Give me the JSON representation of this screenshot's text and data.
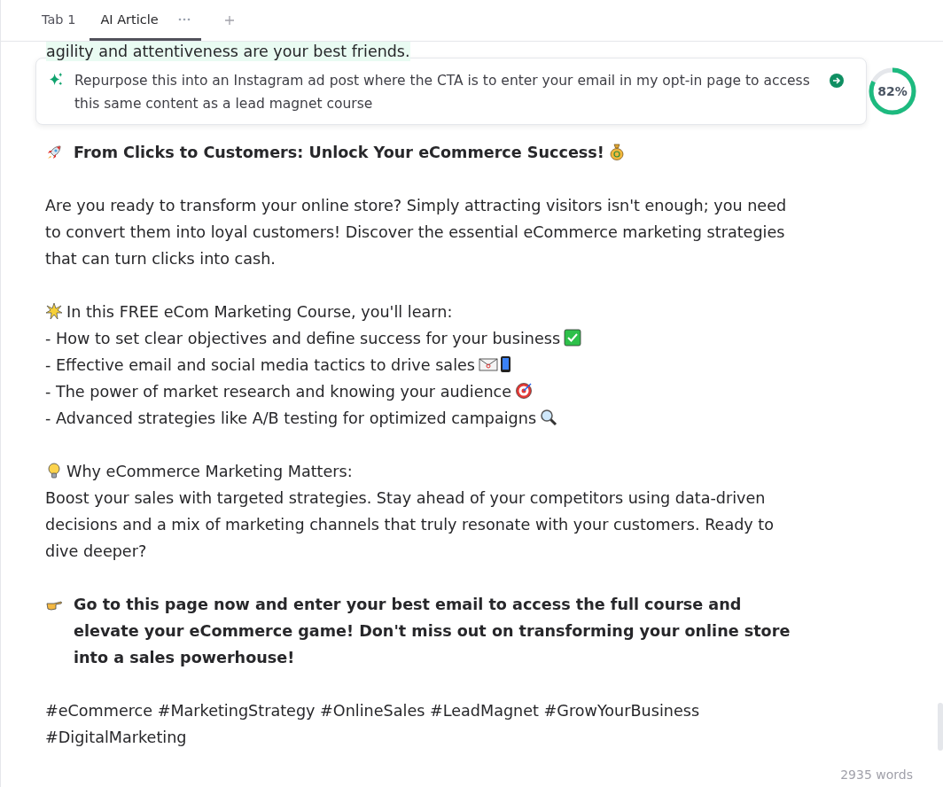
{
  "tabs": [
    {
      "label": "Tab 1",
      "selected": false
    },
    {
      "label": "AI Article",
      "selected": true
    }
  ],
  "hidden_line": "agility and attentiveness are your best friends.",
  "prompt": {
    "text": "Repurpose this into an Instagram ad post where the CTA is to enter your email in my opt-in page to access this same content as a lead magnet course"
  },
  "progress": {
    "level": 0.82,
    "label": "82%"
  },
  "blocks": [
    {
      "kind": "heading",
      "text": "From Clicks to Customers: Unlock Your eCommerce Success!"
    },
    {
      "kind": "paragraph",
      "text": "Are you ready to transform your online store? Simply attracting visitors isn't enough; you need to convert them into loyal customers! Discover the essential eCommerce marketing strategies that can turn clicks into cash."
    },
    {
      "kind": "list",
      "intro": "In this FREE eCom Marketing Course, you'll learn:",
      "items": [
        "- How to set clear objectives and define success for your business",
        "- Effective email and social media tactics to drive sales",
        "- The power of market research and knowing your audience",
        "- Advanced strategies like A/B testing for optimized campaigns"
      ]
    },
    {
      "kind": "list",
      "intro": "Why eCommerce Marketing Matters:",
      "items": [
        "Boost your sales with targeted strategies. Stay ahead of your competitors using data-driven decisions and a mix of marketing channels that truly resonate with your customers. Ready to dive deeper?"
      ]
    },
    {
      "kind": "heading",
      "text": "Go to this page now and enter your best email to access the full course and elevate your eCommerce game! Don't miss out on transforming your online store into a sales powerhouse!"
    },
    {
      "kind": "paragraph",
      "text": "#eCommerce #MarketingStrategy #OnlineSales #LeadMagnet #GrowYourBusiness #DigitalMarketing"
    }
  ],
  "word_count": "2935 words"
}
